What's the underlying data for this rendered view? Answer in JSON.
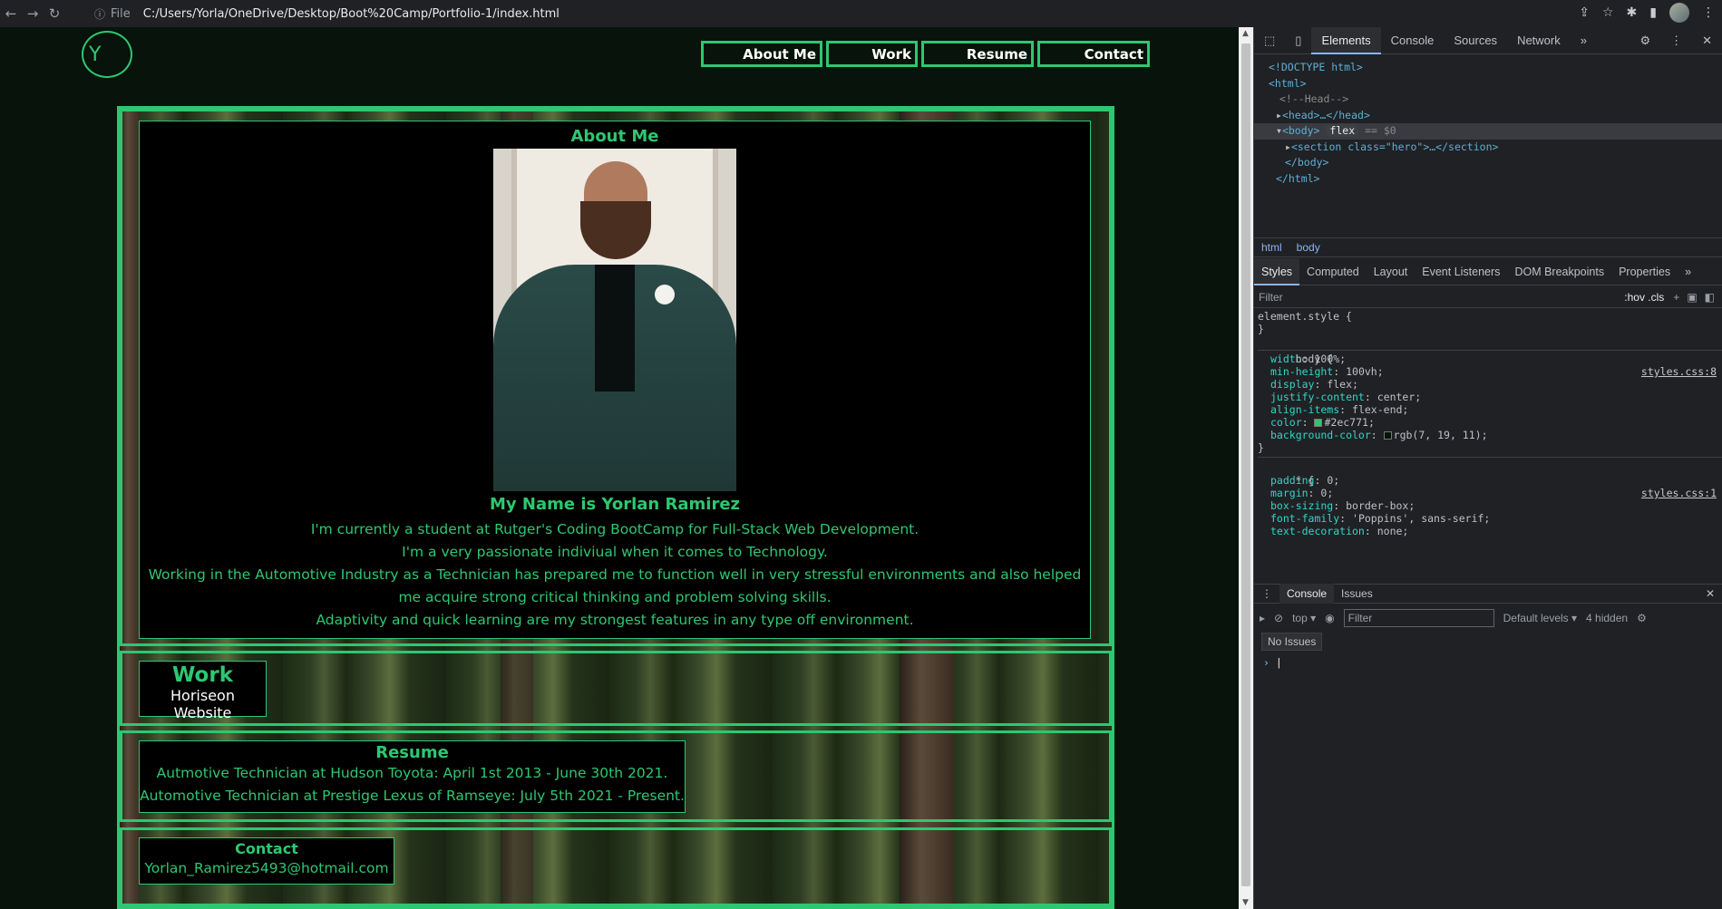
{
  "browser": {
    "scheme_label": "File",
    "url": "C:/Users/Yorla/OneDrive/Desktop/Boot%20Camp/Portfolio-1/index.html"
  },
  "site": {
    "logo_text": "Y",
    "nav": [
      "About Me",
      "Work",
      "Resume",
      "Contact"
    ],
    "about": {
      "title": "About Me",
      "name": "My Name is Yorlan Ramirez",
      "bio": [
        "I'm currently a student at Rutger's Coding BootCamp for Full-Stack Web Development.",
        "I'm a very passionate indiviual when it comes to Technology.",
        "Working in the Automotive Industry as a Technician has prepared me to function well in very stressful environments and also helped",
        "me acquire strong critical thinking and problem solving skills.",
        "Adaptivity and quick learning are my strongest features in any type off environment."
      ]
    },
    "work": {
      "title": "Work",
      "item": "Horiseon Website"
    },
    "resume": {
      "title": "Resume",
      "items": [
        "Autmotive Technician at Hudson Toyota: April 1st 2013 - June 30th 2021.",
        "Automotive Technician at Prestige Lexus of Ramseye: July 5th 2021 - Present."
      ]
    },
    "contact": {
      "title": "Contact",
      "email": "Yorlan_Ramirez5493@hotmail.com"
    }
  },
  "devtools": {
    "tabs": [
      "Elements",
      "Console",
      "Sources",
      "Network"
    ],
    "dom": {
      "doctype": "<!DOCTYPE html>",
      "html_open": "<html>",
      "comment": "<!--Head-->",
      "head": "<head>…</head>",
      "body": "<body>",
      "body_badge": "flex",
      "body_suffix": "== $0",
      "section": "<section class=\"hero\">…</section>",
      "body_close": "</body>",
      "html_close": "</html>"
    },
    "crumbs": [
      "html",
      "body"
    ],
    "style_tabs": [
      "Styles",
      "Computed",
      "Layout",
      "Event Listeners",
      "DOM Breakpoints",
      "Properties"
    ],
    "filter_placeholder": "Filter",
    "filter_tools": ":hov  .cls",
    "styles": {
      "element_style": "element.style {",
      "body_selector": "body {",
      "body_link": "styles.css:8",
      "body_rules": [
        [
          "width",
          "100%;"
        ],
        [
          "min-height",
          "100vh;"
        ],
        [
          "display",
          "flex;"
        ],
        [
          "justify-content",
          "center;"
        ],
        [
          "align-items",
          "flex-end;"
        ],
        [
          "color",
          "#2ec771;"
        ],
        [
          "background-color",
          "rgb(7, 19, 11);"
        ]
      ],
      "star_selector": "* {",
      "star_link": "styles.css:1",
      "star_rules": [
        [
          "padding",
          "0;"
        ],
        [
          "margin",
          "0;"
        ],
        [
          "box-sizing",
          "border-box;"
        ],
        [
          "font-family",
          "'Poppins', sans-serif;"
        ],
        [
          "text-decoration",
          "none;"
        ]
      ]
    },
    "console_tabs": [
      "Console",
      "Issues"
    ],
    "console_context": "top",
    "console_filter": "Filter",
    "console_levels": "Default levels",
    "hidden_count": "4 hidden",
    "no_issues": "No Issues",
    "colors": {
      "accent": "#2ec771",
      "page_bg": "#07130b"
    }
  }
}
